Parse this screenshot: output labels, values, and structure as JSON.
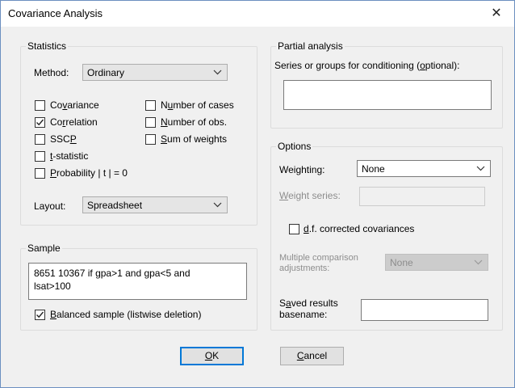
{
  "window": {
    "title": "Covariance Analysis",
    "close_glyph": "✕"
  },
  "statistics": {
    "group_label": "Statistics",
    "method_label": "Method:",
    "method_value": "Ordinary",
    "checks": [
      {
        "label": "Covariance",
        "checked": false
      },
      {
        "label": "Correlation",
        "checked": true
      },
      {
        "label": "SSCP",
        "checked": false
      },
      {
        "label": "t-statistic",
        "checked": false
      },
      {
        "label": "Probability | t | = 0",
        "checked": false
      },
      {
        "label": "Number of cases",
        "checked": false
      },
      {
        "label": "Number of obs.",
        "checked": false
      },
      {
        "label": "Sum of weights",
        "checked": false
      }
    ],
    "layout_label": "Layout:",
    "layout_value": "Spreadsheet"
  },
  "sample": {
    "group_label": "Sample",
    "text_line1": "8651 10367 if gpa>1 and gpa<5 and",
    "text_line2": "lsat>100",
    "balanced_label": "Balanced sample (listwise deletion)",
    "balanced_checked": true
  },
  "partial": {
    "group_label": "Partial analysis",
    "series_label": "Series or groups for conditioning (optional):",
    "series_value": ""
  },
  "options": {
    "group_label": "Options",
    "weighting_label": "Weighting:",
    "weighting_value": "None",
    "weight_series_label": "Weight series:",
    "weight_series_value": "",
    "df_label": "d.f. corrected covariances",
    "df_checked": false,
    "mc_label_line1": "Multiple comparison",
    "mc_label_line2": "adjustments:",
    "mc_value": "None",
    "saved_label_line1": "Saved results",
    "saved_label_line2": "basename:",
    "saved_value": ""
  },
  "buttons": {
    "ok": "OK",
    "cancel": "Cancel"
  }
}
